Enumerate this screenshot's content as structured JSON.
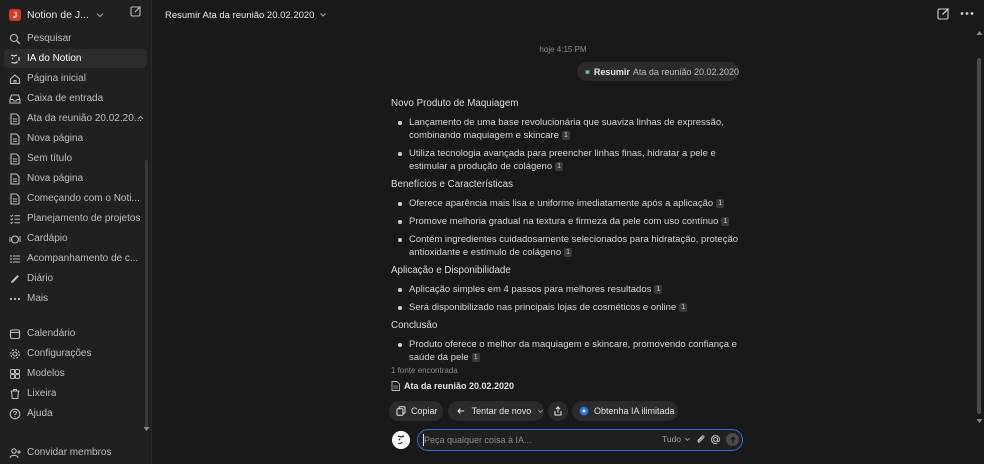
{
  "workspace": {
    "initial": "J",
    "name": "Notion de J..."
  },
  "sidebar": {
    "items": [
      {
        "label": "Pesquisar",
        "icon": "search-icon"
      },
      {
        "label": "IA do Notion",
        "icon": "notion-ai-icon",
        "active": true
      },
      {
        "label": "Página inicial",
        "icon": "home-icon"
      },
      {
        "label": "Caixa de entrada",
        "icon": "inbox-icon"
      },
      {
        "label": "Ata da reunião 20.02.20...",
        "icon": "page-icon"
      },
      {
        "label": "Nova página",
        "icon": "page-icon"
      },
      {
        "label": "Sem título",
        "icon": "page-icon"
      },
      {
        "label": "Nova página",
        "icon": "page-icon"
      },
      {
        "label": "Começando com o Noti...",
        "icon": "page-icon"
      },
      {
        "label": "Planejamento de projetos",
        "icon": "checklist-icon"
      },
      {
        "label": "Cardápio",
        "icon": "menu-icon"
      },
      {
        "label": "Acompanhamento de c...",
        "icon": "list-icon"
      },
      {
        "label": "Diário",
        "icon": "pencil-icon"
      },
      {
        "label": "Mais",
        "icon": "more-icon"
      }
    ],
    "secondary": [
      {
        "label": "Calendário",
        "icon": "calendar-icon"
      },
      {
        "label": "Configurações",
        "icon": "gear-icon"
      },
      {
        "label": "Modelos",
        "icon": "templates-icon"
      },
      {
        "label": "Lixeira",
        "icon": "trash-icon"
      },
      {
        "label": "Ajuda",
        "icon": "help-icon"
      }
    ],
    "invite_label": "Convidar membros"
  },
  "header": {
    "title": "Resumir Ata da reunião 20.02.2020"
  },
  "chat": {
    "timestamp": "hoje 4:15 PM",
    "user_message": {
      "action": "Resumir",
      "target": "Ata da reunião 20.02.2020"
    },
    "answer": {
      "sections": [
        {
          "heading": "Novo Produto de Maquiagem",
          "bullets": [
            {
              "text": "Lançamento de uma base revolucionária que suaviza linhas de expressão, combinando maquiagem e skincare",
              "cite": "1"
            },
            {
              "text": "Utiliza tecnologia avançada para preencher linhas finas, hidratar a pele e estimular a produção de colágeno",
              "cite": "1"
            }
          ]
        },
        {
          "heading": "Benefícios e Características",
          "bullets": [
            {
              "text": "Oferece aparência mais lisa e uniforme imediatamente após a aplicação",
              "cite": "1"
            },
            {
              "text": "Promove melhoria gradual na textura e firmeza da pele com uso contínuo",
              "cite": "1"
            },
            {
              "text": "Contém ingredientes cuidadosamente selecionados para hidratação, proteção antioxidante e estímulo de colágeno",
              "cite": "1"
            }
          ]
        },
        {
          "heading": "Aplicação e Disponibilidade",
          "bullets": [
            {
              "text": "Aplicação simples em 4 passos para melhores resultados",
              "cite": "1"
            },
            {
              "text": "Será disponibilizado nas principais lojas de cosméticos e online",
              "cite": "1"
            }
          ]
        },
        {
          "heading": "Conclusão",
          "bullets": [
            {
              "text": "Produto oferece o melhor da maquiagem e skincare, promovendo confiança e saúde da pele",
              "cite": "1"
            }
          ]
        }
      ]
    },
    "sources_label": "1 fonte encontrada",
    "source_title": "Ata da reunião 20.02.2020",
    "actions": {
      "copy": "Copiar",
      "retry": "Tentar de novo",
      "upgrade": "Obtenha IA ilimitada"
    }
  },
  "input": {
    "placeholder": "Peça qualquer coisa à IA...",
    "scope": "Tudo"
  },
  "colors": {
    "background": "#191919",
    "sidebar": "#202020",
    "accent": "#2a6fd6",
    "workspace_avatar": "#d33b27"
  }
}
